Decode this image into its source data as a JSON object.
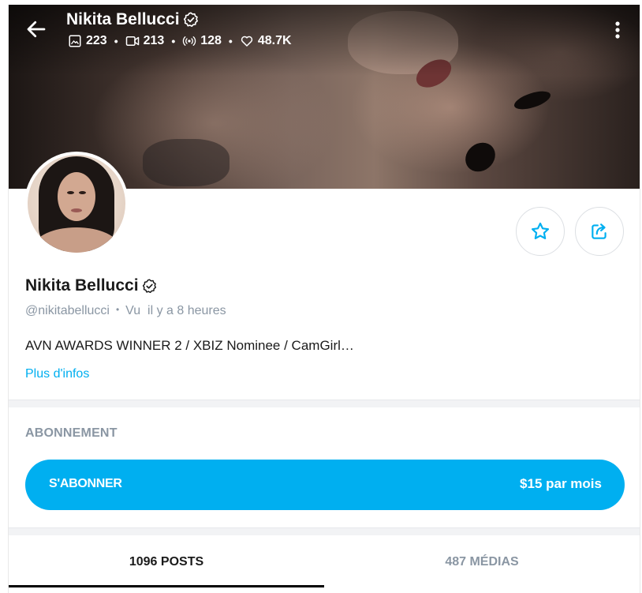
{
  "header": {
    "name": "Nikita Bellucci",
    "stats": [
      {
        "icon": "image-icon",
        "value": "223"
      },
      {
        "icon": "video-icon",
        "value": "213"
      },
      {
        "icon": "stream-icon",
        "value": "128"
      },
      {
        "icon": "heart-icon",
        "value": "48.7K"
      }
    ],
    "separator": "•"
  },
  "profile": {
    "name": "Nikita Bellucci",
    "handle": "@nikitabellucci",
    "separator": "•",
    "last_seen": "Vu  il y a 8 heures",
    "bio": "AVN AWARDS WINNER 2 / XBIZ Nominee / CamGirl…",
    "more_info": "Plus d'infos"
  },
  "subscription": {
    "heading": "ABONNEMENT",
    "button_label": "S'ABONNER",
    "price": "$15 par mois"
  },
  "tabs": [
    {
      "label": "1096 POSTS",
      "active": true
    },
    {
      "label": "487 MÉDIAS",
      "active": false
    }
  ],
  "colors": {
    "accent": "#00aff0",
    "muted_text": "#8a96a3",
    "primary_text": "#1a1a1a"
  },
  "icons": {
    "back": "arrow-left-icon",
    "menu": "more-vertical-icon",
    "verified": "verified-icon",
    "favorite": "star-icon",
    "share": "share-icon"
  }
}
